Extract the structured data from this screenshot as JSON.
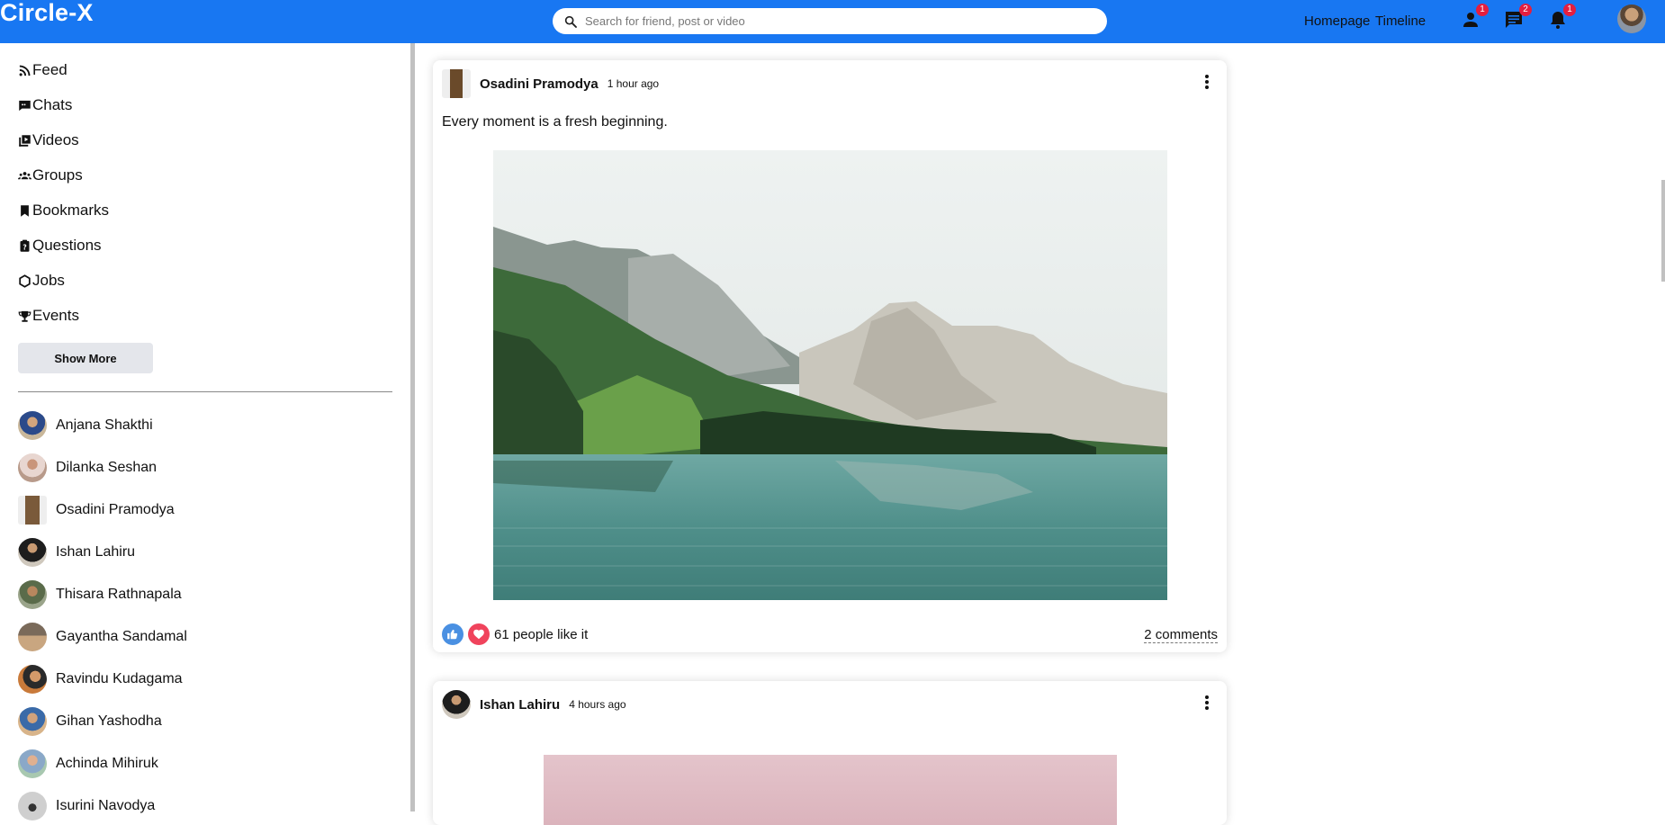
{
  "app": {
    "title": "Circle-X"
  },
  "search": {
    "placeholder": "Search for friend, post or video"
  },
  "nav": {
    "homepage": "Homepage",
    "timeline": "Timeline"
  },
  "notifications": {
    "friends": "1",
    "messages": "2",
    "alerts": "1"
  },
  "sidebar": {
    "items": [
      {
        "label": "Feed",
        "icon": "rss-icon"
      },
      {
        "label": "Chats",
        "icon": "chat-icon"
      },
      {
        "label": "Videos",
        "icon": "video-library-icon"
      },
      {
        "label": "Groups",
        "icon": "group-icon"
      },
      {
        "label": "Bookmarks",
        "icon": "bookmark-icon"
      },
      {
        "label": "Questions",
        "icon": "question-icon"
      },
      {
        "label": "Jobs",
        "icon": "work-icon"
      },
      {
        "label": "Events",
        "icon": "trophy-icon"
      }
    ],
    "show_more": "Show More",
    "friends": [
      "Anjana Shakthi",
      "Dilanka Seshan",
      "Osadini Pramodya",
      "Ishan Lahiru",
      "Thisara Rathnapala",
      "Gayantha Sandamal",
      "Ravindu Kudagama",
      "Gihan Yashodha",
      "Achinda Mihiruk",
      "Isurini Navodya"
    ]
  },
  "posts": [
    {
      "author": "Osadini Pramodya",
      "time": "1 hour ago",
      "text": "Every moment is a fresh beginning.",
      "likes": "61 people like it",
      "comments": "2 comments"
    },
    {
      "author": "Ishan Lahiru",
      "time": "4 hours ago"
    }
  ],
  "colors": {
    "topbar": "#1877f2",
    "like": "#4a90e2",
    "love": "#f0435c",
    "badge": "#e41e3f"
  }
}
